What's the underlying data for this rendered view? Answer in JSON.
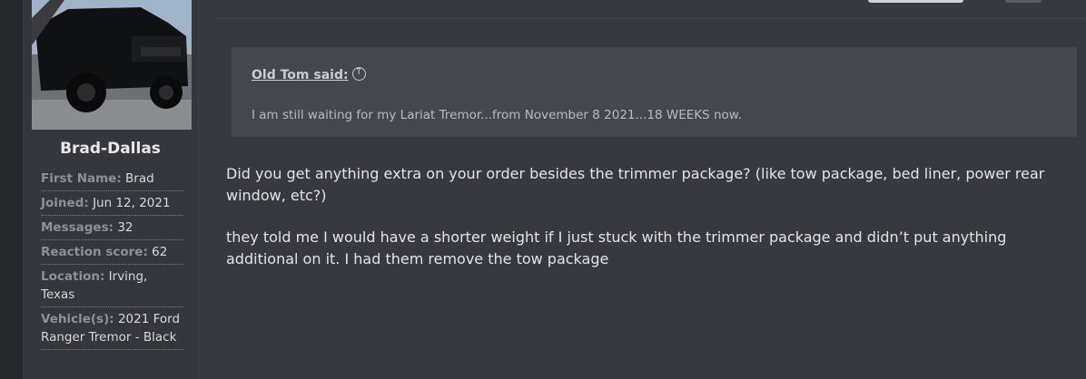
{
  "user": {
    "name": "Brad-Dallas",
    "fields": [
      {
        "label": "First Name:",
        "value": "Brad"
      },
      {
        "label": "Joined:",
        "value": "Jun 12, 2021"
      },
      {
        "label": "Messages:",
        "value": "32"
      },
      {
        "label": "Reaction score:",
        "value": "62"
      },
      {
        "label": "Location:",
        "value": "Irving, Texas"
      },
      {
        "label": "Vehicle(s):",
        "value": "2021 Ford Ranger Tremor - Black"
      }
    ]
  },
  "quote": {
    "author": "Old Tom said:",
    "text": "I am still waiting for my Lariat Tremor...from November 8 2021...18 WEEKS now."
  },
  "post": {
    "paragraphs": [
      "Did you get anything extra on your order besides the trimmer package? (like tow package, bed liner, power rear window, etc?)",
      "they told me I would have a shorter weight if I just stuck with the trimmer package and didn’t put anything additional on it. I had them remove the tow package"
    ]
  }
}
